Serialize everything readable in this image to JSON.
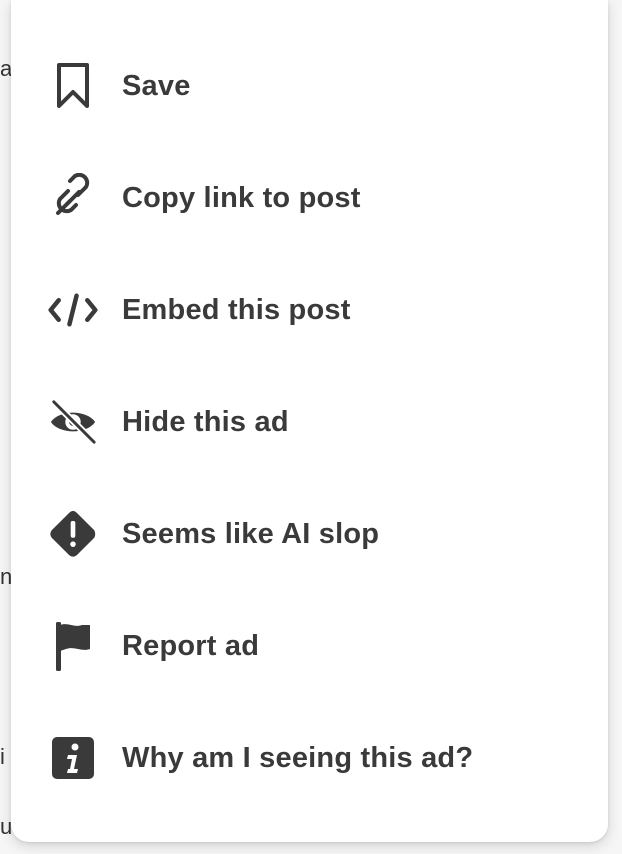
{
  "background": {
    "fragments": [
      "a",
      "n",
      "i",
      "u."
    ]
  },
  "menu": {
    "items": [
      {
        "id": "save",
        "label": "Save",
        "icon": "bookmark-icon"
      },
      {
        "id": "copy-link",
        "label": "Copy link to post",
        "icon": "link-icon"
      },
      {
        "id": "embed",
        "label": "Embed this post",
        "icon": "code-icon"
      },
      {
        "id": "hide-ad",
        "label": "Hide this ad",
        "icon": "eye-slash-icon"
      },
      {
        "id": "ai-slop",
        "label": "Seems like AI slop",
        "icon": "warning-diamond-icon"
      },
      {
        "id": "report-ad",
        "label": "Report ad",
        "icon": "flag-icon"
      },
      {
        "id": "why-ad",
        "label": "Why am I seeing this ad?",
        "icon": "info-icon"
      }
    ]
  },
  "colors": {
    "text": "#3a3a3a",
    "icon": "#3a3a3a",
    "menu_bg": "#ffffff"
  }
}
